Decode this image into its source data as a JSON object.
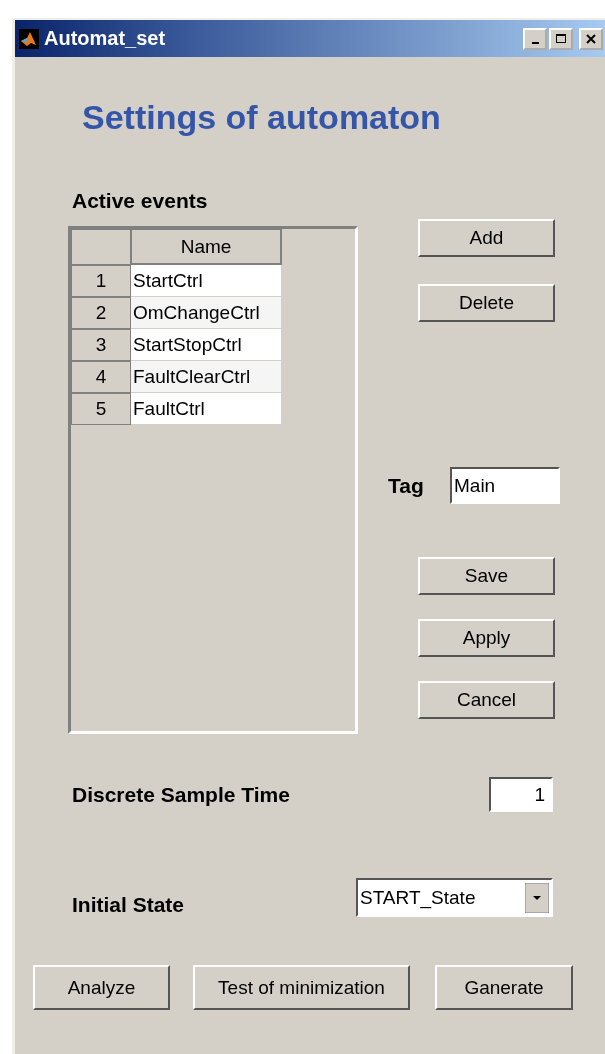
{
  "window": {
    "title": "Automat_set"
  },
  "heading": "Settings of automaton",
  "events": {
    "label": "Active events",
    "columns": [
      "Name"
    ],
    "rows": [
      {
        "index": "1",
        "name": "StartCtrl"
      },
      {
        "index": "2",
        "name": "OmChangeCtrl"
      },
      {
        "index": "3",
        "name": "StartStopCtrl"
      },
      {
        "index": "4",
        "name": "FaultClearCtrl"
      },
      {
        "index": "5",
        "name": "FaultCtrl"
      }
    ]
  },
  "side_buttons": [
    "Add",
    "Delete"
  ],
  "tag": {
    "label": "Tag",
    "value": "Main"
  },
  "action_buttons": [
    "Save",
    "Apply",
    "Cancel"
  ],
  "sample_time": {
    "label": "Discrete Sample Time",
    "value": "1"
  },
  "initial_state": {
    "label": "Initial State",
    "value": "START_State"
  },
  "bottom_buttons": [
    "Analyze",
    "Test of minimization",
    "Ganerate"
  ]
}
